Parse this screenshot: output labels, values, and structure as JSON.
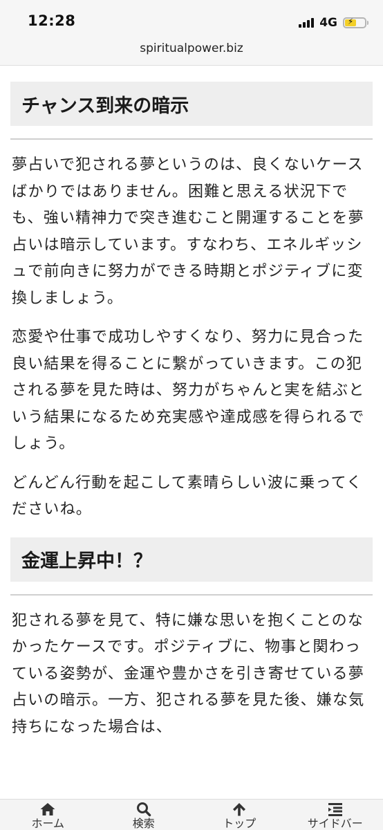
{
  "status_bar": {
    "time": "12:28",
    "network": "4G",
    "bolt": "⚡"
  },
  "browser": {
    "url": "spiritualpower.biz"
  },
  "article": {
    "section1": {
      "heading": "チャンス到来の暗示",
      "paragraphs": [
        "夢占いで犯される夢というのは、良くないケースばかりではありません。困難と思える状況下でも、強い精神力で突き進むこと開運することを夢占いは暗示しています。すなわち、エネルギッシュで前向きに努力ができる時期とポジティブに変換しましょう。",
        "恋愛や仕事で成功しやすくなり、努力に見合った良い結果を得ることに繋がっていきます。この犯される夢を見た時は、努力がちゃんと実を結ぶという結果になるため充実感や達成感を得られるでしょう。",
        "どんどん行動を起こして素晴らしい波に乗ってくださいね。"
      ]
    },
    "section2": {
      "heading": "金運上昇中！？",
      "paragraphs": [
        "犯される夢を見て、特に嫌な思いを抱くことのなかったケースです。ポジティブに、物事と関わっている姿勢が、金運や豊かさを引き寄せている夢占いの暗示。一方、犯される夢を見た後、嫌な気持ちになった場合は、"
      ]
    }
  },
  "bottom_nav": {
    "items": [
      {
        "label": "ホーム",
        "icon": "home-icon"
      },
      {
        "label": "検索",
        "icon": "search-icon"
      },
      {
        "label": "トップ",
        "icon": "arrow-up-icon"
      },
      {
        "label": "サイドバー",
        "icon": "sidebar-icon"
      }
    ]
  },
  "colors": {
    "heading_bg": "#eeeeee",
    "battery": "#f3cf28",
    "nav_bg": "#f4f4f4"
  }
}
